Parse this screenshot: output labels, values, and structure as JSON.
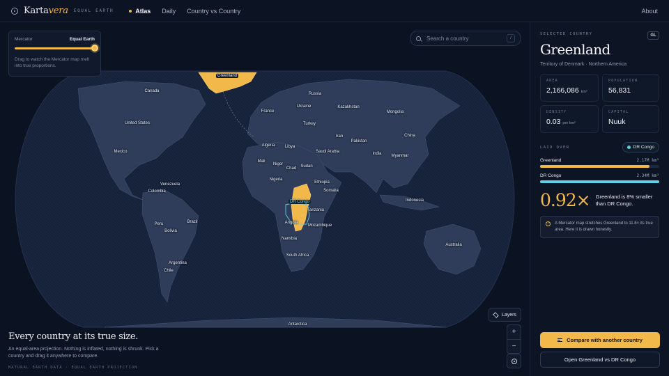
{
  "app": {
    "brand_main": "Karta",
    "brand_accent": "vera",
    "brand_tag": "Equal Earth",
    "nav": [
      "Atlas",
      "Daily",
      "Country vs Country"
    ],
    "about": "About"
  },
  "projection_slider": {
    "left_label": "Mercator",
    "right_label": "Equal Earth",
    "value_fraction": 1.0,
    "hint": "Drag to watch the Mercator map melt into true proportions."
  },
  "search": {
    "placeholder": "Search a country",
    "shortcut": "/"
  },
  "map": {
    "labels": {
      "greenland": "Greenland",
      "canada": "Canada",
      "russia": "Russia",
      "united_states": "United States",
      "france": "France",
      "ukraine": "Ukraine",
      "kazakhstan": "Kazakhstan",
      "mongolia": "Mongolia",
      "turkey": "Turkey",
      "china": "China",
      "iran": "Iran",
      "pakistan": "Pakistan",
      "mexico": "Mexico",
      "algeria": "Algeria",
      "libya": "Libya",
      "saudi_arabia": "Saudi Arabia",
      "india": "India",
      "myanmar": "Myanmar",
      "mali": "Mali",
      "niger": "Niger",
      "chad": "Chad",
      "sudan": "Sudan",
      "venezuela": "Venezuela",
      "nigeria": "Nigeria",
      "ethiopia": "Ethiopia",
      "colombia": "Colombia",
      "somalia": "Somalia",
      "dr_congo": "DR Congo",
      "indonesia": "Indonesia",
      "tanzania": "Tanzania",
      "peru": "Peru",
      "brazil": "Brazil",
      "angola": "Angola",
      "mozambique": "Mozambique",
      "bolivia": "Bolivia",
      "namibia": "Namibia",
      "australia": "Australia",
      "south_africa": "South Africa",
      "argentina": "Argentina",
      "chile": "Chile",
      "antarctica": "Antarctica"
    },
    "layers_label": "Layers",
    "zoom_in": "+",
    "zoom_out": "−"
  },
  "intro": {
    "title": "Every country at its true size.",
    "body": "An equal-area projection. Nothing is inflated, nothing is shrunk. Pick a country and drag it anywhere to compare.",
    "source": "Natural Earth Data · Equal Earth Projection"
  },
  "panel": {
    "eyebrow": "Selected Country",
    "code": "GL",
    "title": "Greenland",
    "subtitle": "Territory of Denmark · Northern America",
    "stats": {
      "area_label": "Area",
      "area_value": "2,166,086",
      "area_unit": "km²",
      "population_label": "Population",
      "population_value": "56,831",
      "density_label": "Density",
      "density_value": "0.03",
      "density_unit": "per km²",
      "capital_label": "Capital",
      "capital_value": "Nuuk"
    },
    "laid_over_label": "Laid over",
    "laid_over_country": "DR Congo",
    "bars": [
      {
        "name": "Greenland",
        "value_text": "2.17M km²",
        "fraction": 0.92,
        "color": "#f2b94a"
      },
      {
        "name": "DR Congo",
        "value_text": "2.34M km²",
        "fraction": 1.0,
        "color": "#62d0e3"
      }
    ],
    "ratio": "0.92×",
    "ratio_text": "Greenland is 8% smaller than DR Congo.",
    "note": "A Mercator map stretches Greenland to 11.8× its true area. Here it is drawn honestly.",
    "cta_primary": "Compare with another country",
    "cta_secondary": "Open Greenland vs DR Congo"
  },
  "colors": {
    "accent": "#f2b94a",
    "overlay": "#62d0e3",
    "land": "#2f3d5a",
    "ocean": "#16213a"
  }
}
